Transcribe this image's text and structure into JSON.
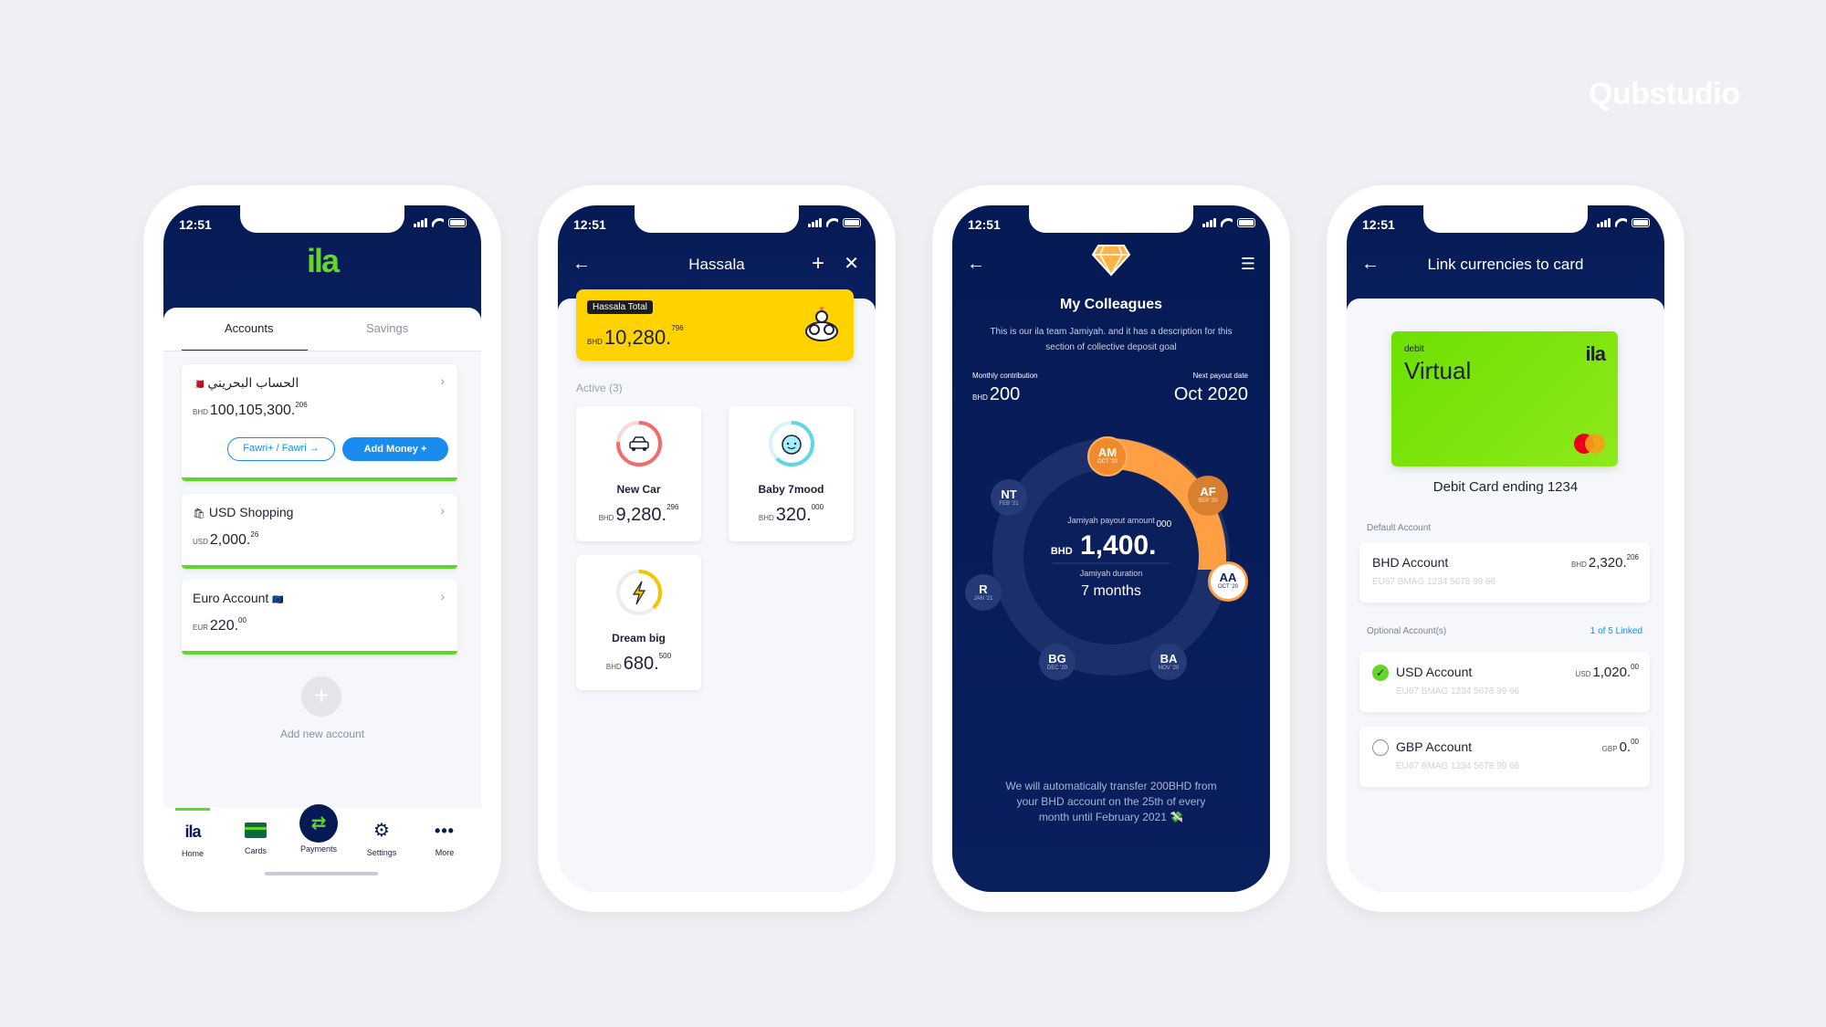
{
  "brand": "Qubstudio",
  "status_time": "12:51",
  "phone1": {
    "logo": "ila",
    "tabs": [
      "Accounts",
      "Savings"
    ],
    "accounts": [
      {
        "flag": "🇧🇭",
        "name": "الحساب البحريني",
        "currency": "BHD",
        "amount": "100,105,300.",
        "fraction": "206"
      },
      {
        "flag": "🛍",
        "name": "USD Shopping",
        "currency": "USD",
        "amount": "2,000.",
        "fraction": "26"
      },
      {
        "flag": "🇪🇺",
        "name": "Euro Account",
        "currency": "EUR",
        "amount": "220.",
        "fraction": "00"
      }
    ],
    "fawri_label": "Fawri+ / Fawri →",
    "add_money_label": "Add Money +",
    "add_new": "Add new account",
    "nav": [
      "Home",
      "Cards",
      "Payments",
      "Settings",
      "More"
    ]
  },
  "phone2": {
    "title": "Hassala",
    "total_label": "Hassala Total",
    "total_currency": "BHD",
    "total_amount": "10,280.",
    "total_fraction": "796",
    "active_label": "Active (3)",
    "goals": [
      {
        "name": "New Car",
        "currency": "BHD",
        "amount": "9,280.",
        "fraction": "296",
        "color": "#f36b6b"
      },
      {
        "name": "Baby 7mood",
        "currency": "BHD",
        "amount": "320.",
        "fraction": "000",
        "color": "#5fd7e6"
      },
      {
        "name": "Dream big",
        "currency": "BHD",
        "amount": "680.",
        "fraction": "500",
        "color": "#f5c400"
      }
    ]
  },
  "phone3": {
    "title": "My Colleagues",
    "description": "This is our ila team Jamiyah. and it has a description for this section of collective deposit goal",
    "monthly_label": "Monthly contribution",
    "monthly_currency": "BHD",
    "monthly_value": "200",
    "payout_label": "Next payout date",
    "payout_value": "Oct 2020",
    "center_amount_label": "Jamiyah payout amount",
    "center_currency": "BHD",
    "center_amount": "1,400.",
    "center_fraction": "000",
    "duration_label": "Jamiyah duration",
    "duration_value": "7 months",
    "members": [
      {
        "initials": "AM",
        "date": "OCT '20"
      },
      {
        "initials": "AF",
        "date": "SEP '20"
      },
      {
        "initials": "AA",
        "date": "OCT '20"
      },
      {
        "initials": "BA",
        "date": "NOV '20"
      },
      {
        "initials": "BG",
        "date": "DEC '20"
      },
      {
        "initials": "R",
        "date": "JAN '21"
      },
      {
        "initials": "NT",
        "date": "FEB '21"
      }
    ],
    "footer": "We will automatically transfer 200BHD from your BHD account on the 25th of every month until February 2021 💸"
  },
  "phone4": {
    "title": "Link currencies to card",
    "card_type": "debit",
    "card_name": "Virtual",
    "card_logo": "ila",
    "card_caption": "Debit Card ending 1234",
    "default_label": "Default Account",
    "optional_label": "Optional Account(s)",
    "linked_label": "1 of 5 Linked",
    "accounts": [
      {
        "name": "BHD Account",
        "iban": "EU67 BMAG 1234 5678 99 66",
        "currency": "BHD",
        "amount": "2,320.",
        "fraction": "206"
      },
      {
        "name": "USD Account",
        "iban": "EU67 BMAG 1234 5678 99 66",
        "currency": "USD",
        "amount": "1,020.",
        "fraction": "00",
        "checked": true
      },
      {
        "name": "GBP Account",
        "iban": "EU67 BMAG 1234 5678 99 66",
        "currency": "GBP",
        "amount": "0.",
        "fraction": "00",
        "checked": false
      }
    ]
  },
  "colors": {
    "navy": "#061a55",
    "green": "#62d62a",
    "blue": "#1a8cf0",
    "yellow": "#ffd200",
    "orange": "#ff9f43"
  }
}
